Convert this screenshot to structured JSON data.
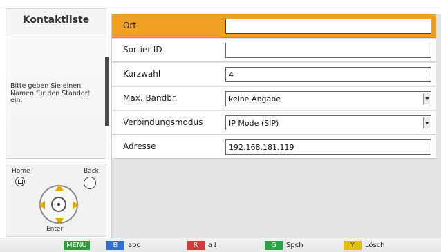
{
  "left_panel": {
    "title": "Kontaktliste",
    "help_text": "Bitte geben Sie einen Namen für den Standort ein."
  },
  "nav": {
    "home_label": "Home",
    "back_label": "Back",
    "enter_label": "Enter"
  },
  "form": {
    "rows": [
      {
        "label": "Ort",
        "value": "",
        "type": "text",
        "active": true
      },
      {
        "label": "Sortier-ID",
        "value": "",
        "type": "text",
        "active": false
      },
      {
        "label": "Kurzwahl",
        "value": "4",
        "type": "text",
        "active": false
      },
      {
        "label": "Max. Bandbr.",
        "value": "keine Angabe",
        "type": "select",
        "active": false
      },
      {
        "label": "Verbindungsmodus",
        "value": "IP Mode (SIP)",
        "type": "select",
        "active": false
      },
      {
        "label": "Adresse",
        "value": "192.168.181.119",
        "type": "text",
        "active": false
      }
    ]
  },
  "bottom_bar": {
    "keys": [
      {
        "chip": "MENU",
        "text": "",
        "color": "#2a9d3a"
      },
      {
        "chip": "B",
        "text": "abc",
        "color": "#2f6fd0"
      },
      {
        "chip": "R",
        "text": "a↓",
        "color": "#d23b3b"
      },
      {
        "chip": "G",
        "text": "Spch",
        "color": "#2aa44a"
      },
      {
        "chip": "Y",
        "text": "Lösch",
        "color": "#e0c000"
      }
    ]
  },
  "colors": {
    "active_row": "#f0a020",
    "form_bg": "#e3e3e6"
  }
}
